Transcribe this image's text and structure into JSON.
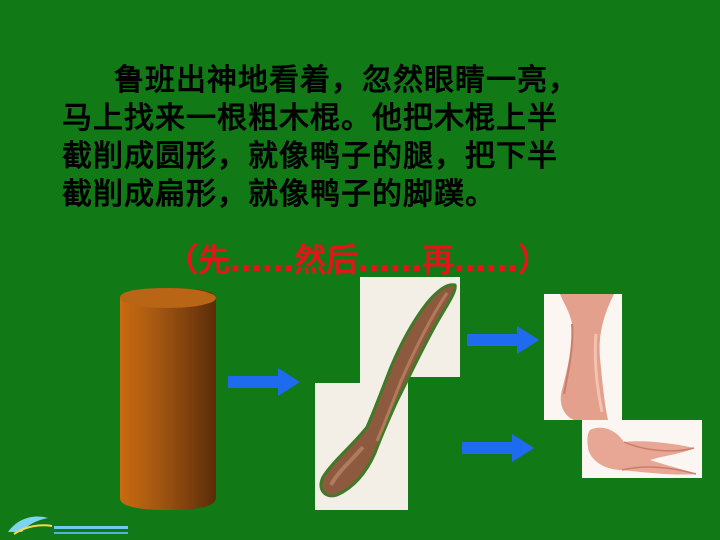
{
  "text": {
    "lines": [
      "鲁班出神地看着，忽然眼睛一亮，",
      "马上找来一根粗木棍。他把木棍上半",
      "截削成圆形，就像鸭子的腿，把下半",
      "截削成扁形，就像鸭子的脚蹼。"
    ],
    "hint": "（先……然后……再……）"
  },
  "colors": {
    "background": "#117A17",
    "hint": "#E8121C",
    "arrow": "#1E6BF0",
    "wood": "#A5651C"
  },
  "icons": {
    "arrow": "right-arrow-icon",
    "logo": "logo-icon"
  }
}
